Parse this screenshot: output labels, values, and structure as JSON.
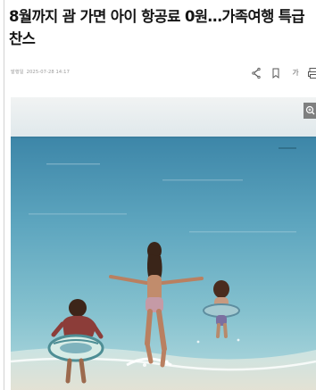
{
  "article": {
    "headline": "8월까지 괌 가면 아이 항공료 0원…가족여행 특급 찬스",
    "byline_label": "발행일",
    "published_at": "2025-07-28 14:17"
  },
  "toolbar": {
    "share_icon": "share-icon",
    "bookmark_icon": "bookmark-icon",
    "font_size_label": "가",
    "print_icon": "print-icon"
  },
  "photo": {
    "zoom_icon": "zoom-icon",
    "subject": "three girls running into shallow turquoise sea with float rings"
  },
  "colors": {
    "headline": "#151515",
    "meta": "#9a9a9a",
    "sea_deep": "#3f8fb1",
    "sea_shallow": "#8fc6d2",
    "sky": "#e9eef0"
  }
}
